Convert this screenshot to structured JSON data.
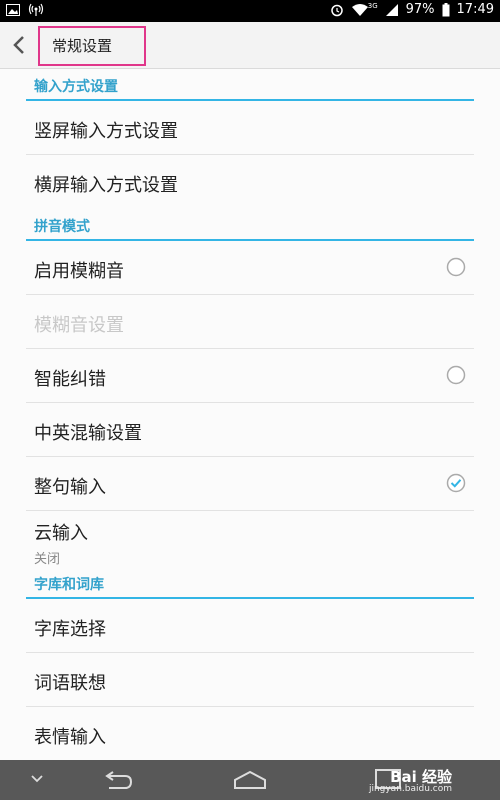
{
  "status_bar": {
    "battery": "97%",
    "time": "17:49",
    "network": "3G",
    "icons": [
      "image-icon",
      "signal-broadcast-icon",
      "alarm-icon",
      "wifi-icon",
      "cell-signal-icon",
      "battery-icon"
    ]
  },
  "header": {
    "back_icon": "chevron-left-icon",
    "title": "常规设置",
    "highlight_color": "#e0368a"
  },
  "sections": [
    {
      "title": "输入方式设置"
    },
    {
      "title": "拼音模式"
    },
    {
      "title": "字库和词库"
    }
  ],
  "items": [
    {
      "label": "竖屏输入方式设置"
    },
    {
      "label": "横屏输入方式设置"
    },
    {
      "label": "启用模糊音",
      "checked": false
    },
    {
      "label": "模糊音设置",
      "disabled": true
    },
    {
      "label": "智能纠错",
      "checked": false
    },
    {
      "label": "中英混输设置"
    },
    {
      "label": "整句输入",
      "checked": true
    },
    {
      "label": "云输入",
      "summary": "关闭"
    },
    {
      "label": "字库选择"
    },
    {
      "label": "词语联想"
    },
    {
      "label": "表情输入"
    }
  ],
  "nav_bar": {
    "icons": [
      "hide-keyboard-icon",
      "back-icon",
      "home-icon",
      "recents-icon"
    ],
    "watermark": "Bai 经验",
    "watermark_url": "jingyan.baidu.com"
  },
  "colors": {
    "accent": "#33b5e5",
    "section_text": "#33a2cc",
    "status_bar": "#000000",
    "nav_bar": "#585858"
  }
}
